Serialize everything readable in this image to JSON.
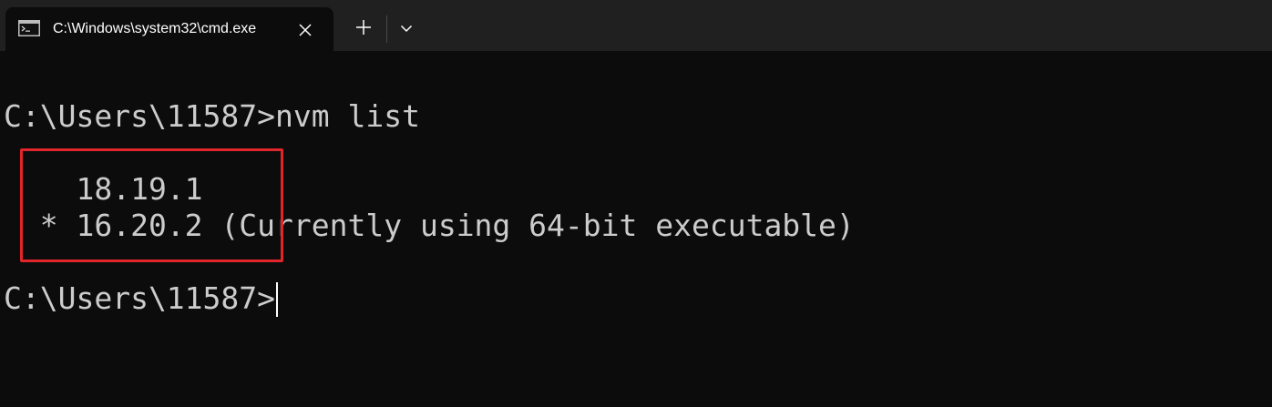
{
  "tab": {
    "title": "C:\\Windows\\system32\\cmd.exe",
    "icon": "cmd-console-icon",
    "close_icon": "close-icon"
  },
  "toolbar": {
    "new_tab_icon": "plus-icon",
    "dropdown_icon": "chevron-down-icon"
  },
  "console": {
    "command_line": "C:\\Users\\11587>nvm list",
    "versions": [
      "    18.19.1",
      "  * 16.20.2 (Currently using 64-bit executable)"
    ],
    "prompt": "C:\\Users\\11587>"
  },
  "colors": {
    "background": "#0c0c0c",
    "tabbar": "#202020",
    "text": "#cccccc",
    "highlight_border": "#e0262b"
  }
}
